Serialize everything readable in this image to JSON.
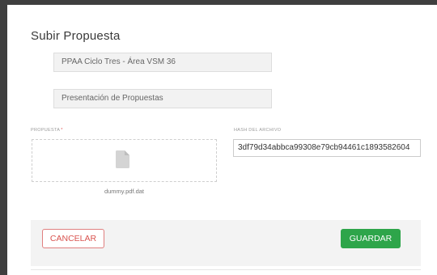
{
  "modal": {
    "title": "Subir Propuesta",
    "fields": {
      "process": "PPAA Ciclo Tres - Área VSM 36",
      "stage": "Presentación de Propuestas"
    },
    "upload": {
      "label": "PROPUESTA",
      "required_mark": "*",
      "file_name": "dummy.pdf.dat",
      "icon": "file-icon"
    },
    "hash": {
      "label": "HASH DEL ARCHIVO",
      "value": "3df79d34abbca99308e79cb94461c1893582604"
    },
    "footer": {
      "cancel_label": "CANCELAR",
      "save_label": "GUARDAR"
    }
  },
  "colors": {
    "cancel": "#d9534f",
    "save": "#2ea54a"
  }
}
